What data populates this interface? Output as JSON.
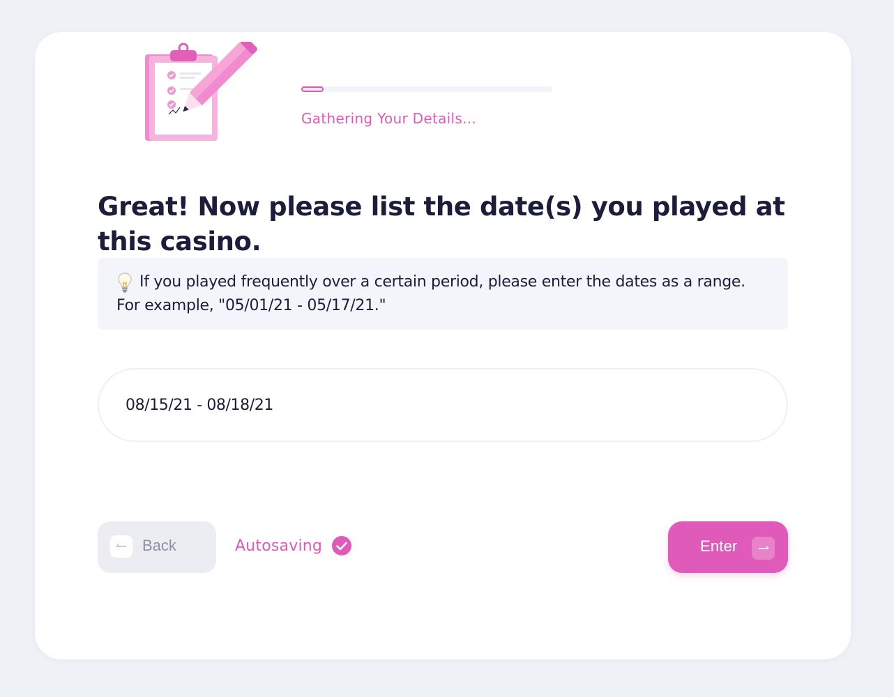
{
  "progress": {
    "label": "Gathering Your Details...",
    "fraction": 0.09
  },
  "question": {
    "title": "Great! Now please list the date(s) you played at this casino."
  },
  "hint": {
    "icon": "lightbulb-icon",
    "text": "If you played frequently over a certain period, please enter the dates as a range. For example, \"05/01/21 - 05/17/21.\""
  },
  "answer": {
    "value": "08/15/21 - 08/18/21"
  },
  "footer": {
    "back_label": "Back",
    "autosave_label": "Autosaving",
    "enter_label": "Enter"
  },
  "colors": {
    "accent": "#e05ab9",
    "text": "#1b1d3a",
    "background": "#eef1f6"
  }
}
